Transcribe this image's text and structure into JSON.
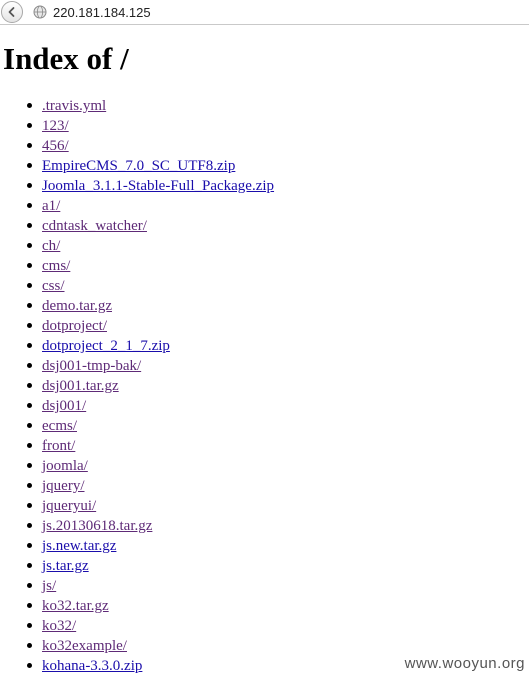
{
  "browser": {
    "back_icon": "back-arrow-icon",
    "site_icon": "globe-icon",
    "url": "220.181.184.125"
  },
  "page": {
    "title": "Index of /"
  },
  "entries": [
    {
      "name": ".travis.yml",
      "visited": true
    },
    {
      "name": "123/",
      "visited": true
    },
    {
      "name": "456/",
      "visited": true
    },
    {
      "name": "EmpireCMS_7.0_SC_UTF8.zip",
      "visited": false
    },
    {
      "name": "Joomla_3.1.1-Stable-Full_Package.zip",
      "visited": false
    },
    {
      "name": "a1/",
      "visited": true
    },
    {
      "name": "cdntask_watcher/",
      "visited": true
    },
    {
      "name": "ch/",
      "visited": true
    },
    {
      "name": "cms/",
      "visited": true
    },
    {
      "name": "css/",
      "visited": true
    },
    {
      "name": "demo.tar.gz",
      "visited": true
    },
    {
      "name": "dotproject/",
      "visited": true
    },
    {
      "name": "dotproject_2_1_7.zip",
      "visited": false
    },
    {
      "name": "dsj001-tmp-bak/",
      "visited": true
    },
    {
      "name": "dsj001.tar.gz",
      "visited": true
    },
    {
      "name": "dsj001/",
      "visited": true
    },
    {
      "name": "ecms/",
      "visited": true
    },
    {
      "name": "front/",
      "visited": true
    },
    {
      "name": "joomla/",
      "visited": true
    },
    {
      "name": "jquery/",
      "visited": true
    },
    {
      "name": "jqueryui/",
      "visited": true
    },
    {
      "name": "js.20130618.tar.gz",
      "visited": true
    },
    {
      "name": "js.new.tar.gz",
      "visited": false
    },
    {
      "name": "js.tar.gz",
      "visited": false
    },
    {
      "name": "js/",
      "visited": true
    },
    {
      "name": "ko32.tar.gz",
      "visited": true
    },
    {
      "name": "ko32/",
      "visited": true
    },
    {
      "name": "ko32example/",
      "visited": true
    },
    {
      "name": "kohana-3.3.0.zip",
      "visited": false
    }
  ],
  "watermark": "www.wooyun.org",
  "colors": {
    "link": "#1a0dab",
    "visited_link": "#5e2a77"
  }
}
